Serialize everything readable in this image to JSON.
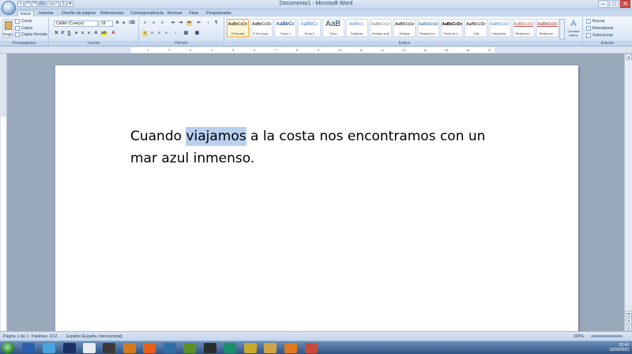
{
  "window": {
    "title": "Documento1 - Microsoft Word"
  },
  "tabs": [
    "Inicio",
    "Insertar",
    "Diseño de página",
    "Referencias",
    "Correspondencia",
    "Revisar",
    "Vista",
    "Programador"
  ],
  "clipboard": {
    "paste": "Pegar",
    "cut": "Cortar",
    "copy": "Copiar",
    "format_painter": "Copiar formato",
    "label": "Portapapeles"
  },
  "font": {
    "name": "Calibri (Cuerpo)",
    "size": "18",
    "label": "Fuente"
  },
  "paragraph": {
    "label": "Párrafo"
  },
  "styles": {
    "items": [
      {
        "preview": "AaBbCcDc",
        "name": "¶ Normal"
      },
      {
        "preview": "AaBbCcDc",
        "name": "¶ Sin espa..."
      },
      {
        "preview": "AaBbCc",
        "name": "Título 1"
      },
      {
        "preview": "AaBbCc",
        "name": "Título 2"
      },
      {
        "preview": "AaB",
        "name": "Título"
      },
      {
        "preview": "AaBbCc.",
        "name": "Subtítulo"
      },
      {
        "preview": "AaBbCcDc",
        "name": "Énfasis sutil"
      },
      {
        "preview": "AaBbCcDc",
        "name": "Énfasis"
      },
      {
        "preview": "AaBbCcDc",
        "name": "Énfasis int..."
      },
      {
        "preview": "AaBbCcDc",
        "name": "Texto en n..."
      },
      {
        "preview": "AaBbCcDc",
        "name": "Cita"
      },
      {
        "preview": "AaBbCcDc",
        "name": "Cita desta..."
      },
      {
        "preview": "AaBbCcDc",
        "name": "Referenci..."
      },
      {
        "preview": "AaBbCcDc",
        "name": "Referenci..."
      }
    ],
    "change_label": "Cambiar estilos",
    "label": "Estilos"
  },
  "editing": {
    "find": "Buscar",
    "replace": "Reemplazar",
    "select": "Seleccionar",
    "label": "Edición"
  },
  "document": {
    "before": "Cuando ",
    "selected": "viajamos",
    "after": " a la costa nos encontramos con un mar azul inmenso."
  },
  "ruler_ticks": [
    "1",
    "2",
    "3",
    "4",
    "5",
    "6",
    "7",
    "8",
    "9",
    "10",
    "11",
    "12",
    "13",
    "14",
    "15",
    "16",
    "17"
  ],
  "status": {
    "page": "Página: 1 de 1",
    "words": "Palabras: 1/12",
    "language": "Español (España, internacional)",
    "zoom": "200%"
  },
  "clock": {
    "time": "22:40",
    "date": "15/05/2023"
  }
}
